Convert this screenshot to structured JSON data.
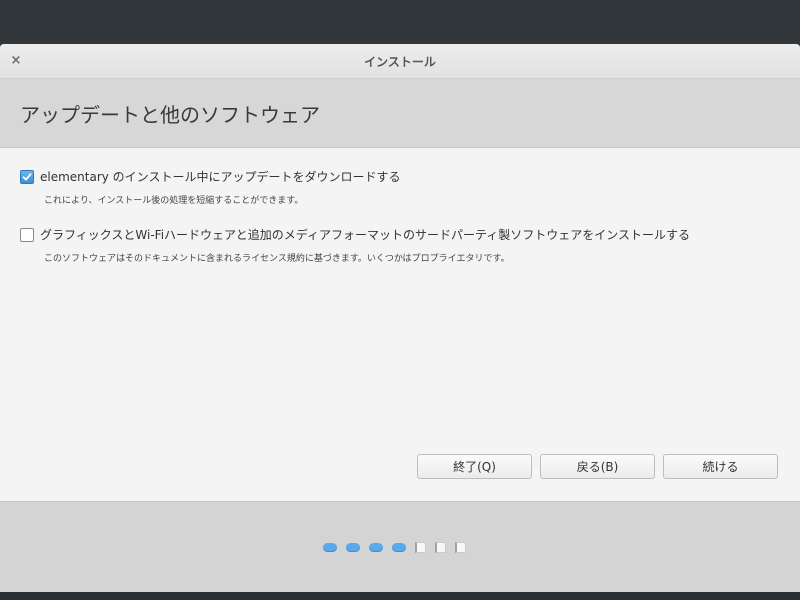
{
  "window": {
    "title": "インストール",
    "close_icon": "×"
  },
  "header": {
    "title": "アップデートと他のソフトウェア"
  },
  "options": [
    {
      "label": "elementary のインストール中にアップデートをダウンロードする",
      "description": "これにより、インストール後の処理を短縮することができます。",
      "checked": true
    },
    {
      "label": "グラフィックスとWi-Fiハードウェアと追加のメディアフォーマットのサードパーティ製ソフトウェアをインストールする",
      "description": "このソフトウェアはそのドキュメントに含まれるライセンス規約に基づきます。いくつかはプロプライエタリです。",
      "checked": false
    }
  ],
  "buttons": {
    "quit": "終了(Q)",
    "back": "戻る(B)",
    "continue": "続ける"
  },
  "progress": {
    "completed_steps": 4,
    "remaining_steps": 3,
    "accent_color": "#5aa9ea"
  }
}
